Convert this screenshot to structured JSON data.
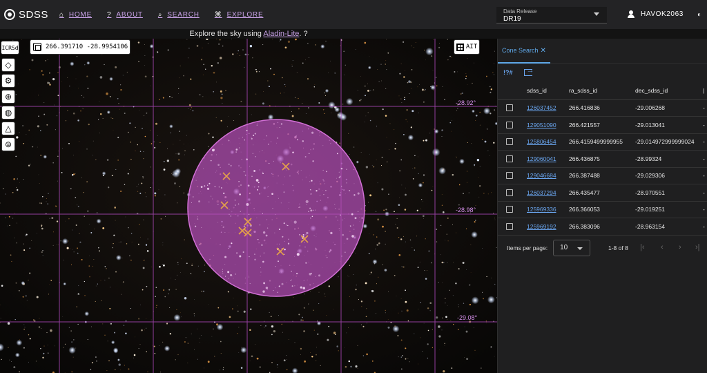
{
  "header": {
    "brand": "SDSS",
    "nav": [
      {
        "icon": "home-icon",
        "glyph": "⌂",
        "label": "HOME"
      },
      {
        "icon": "help-icon",
        "glyph": "?",
        "label": "ABOUT"
      },
      {
        "icon": "search-icon",
        "glyph": "⌕",
        "label": "SEARCH"
      },
      {
        "icon": "binoculars-icon",
        "glyph": "⌘",
        "label": "EXPLORE"
      }
    ],
    "release_label": "Data Release",
    "release_value": "DR19",
    "username": "HAVOK2063"
  },
  "subheader": {
    "prefix": "Explore the sky using ",
    "link": "Aladin-Lite",
    "suffix": ".  ?"
  },
  "sky": {
    "frame": "ICRSd",
    "coordinates": "266.391710 -28.9954106",
    "projection": "AIT",
    "grid_labels": [
      "-28.92°",
      "-28.98°",
      "-29.08°"
    ],
    "cone_color": "#b44fb8"
  },
  "panel": {
    "tab_label": "Cone Search",
    "columns": [
      "sdss_id",
      "ra_sdss_id",
      "dec_sdss_id"
    ],
    "rows": [
      {
        "id": "126037452",
        "ra": "266.416836",
        "dec": "-29.006268"
      },
      {
        "id": "129051090",
        "ra": "266.421557",
        "dec": "-29.013041"
      },
      {
        "id": "125806454",
        "ra": "266.4159499999955",
        "dec": "-29.014972999999024"
      },
      {
        "id": "129060041",
        "ra": "266.436875",
        "dec": "-28.99324"
      },
      {
        "id": "129046684",
        "ra": "266.387488",
        "dec": "-29.029306"
      },
      {
        "id": "126037294",
        "ra": "266.435477",
        "dec": "-28.970551"
      },
      {
        "id": "125969336",
        "ra": "266.366053",
        "dec": "-29.019251"
      },
      {
        "id": "125969192",
        "ra": "266.383096",
        "dec": "-28.963154"
      }
    ],
    "items_per_page_label": "Items per page:",
    "items_per_page": "10",
    "range": "1-8 of 8"
  }
}
